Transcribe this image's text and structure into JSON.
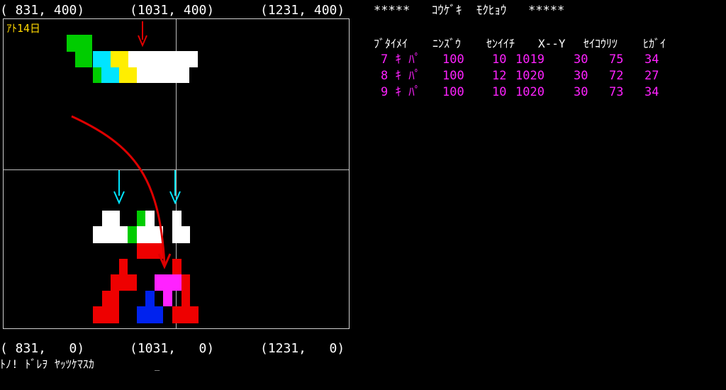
{
  "coords": {
    "top": [
      "( 831, 400)",
      "(1031, 400)",
      "(1231, 400)"
    ],
    "bottom": [
      "( 831,   0)",
      "(1031,   0)",
      "(1231,   0)"
    ]
  },
  "days_left": "ｱﾄ14日",
  "panel": {
    "title": "*****   ｺｳｹﾞｷ  ﾓｸﾋｮｳ   *****",
    "headers": [
      "ﾌﾞﾀｲﾒｲ",
      "ﾆﾝｽﾞｳ",
      "ｾﾝｲｲﾁ",
      "X--Y",
      "ｾｲｺｳﾘﾂ",
      "ﾋｶﾞｲ"
    ],
    "rows": [
      {
        "name": "7 ｷ ﾊﾟ",
        "count": "100",
        "x": "10",
        "y": "1019",
        "pos": "30",
        "rate": "75",
        "damage": "34"
      },
      {
        "name": "8 ｷ ﾊﾟ",
        "count": "100",
        "x": "12",
        "y": "1020",
        "pos": "30",
        "rate": "72",
        "damage": "27"
      },
      {
        "name": "9 ｷ ﾊﾟ",
        "count": "100",
        "x": "10",
        "y": "1020",
        "pos": "30",
        "rate": "73",
        "damage": "34"
      }
    ]
  },
  "prompt": "ﾄﾉ! ﾄﾞﾚｦ ﾔｯﾂｹﾏｽｶ",
  "cursor": "_",
  "colors": {
    "green": "#00cc00",
    "cyan": "#00e5ff",
    "yellow": "#ffee00",
    "white": "#ffffff",
    "red": "#ee0000",
    "magenta": "#ff22ff",
    "blue": "#0022ee",
    "arrow_red": "#dd0000",
    "arrow_cyan": "#00e5ff"
  }
}
